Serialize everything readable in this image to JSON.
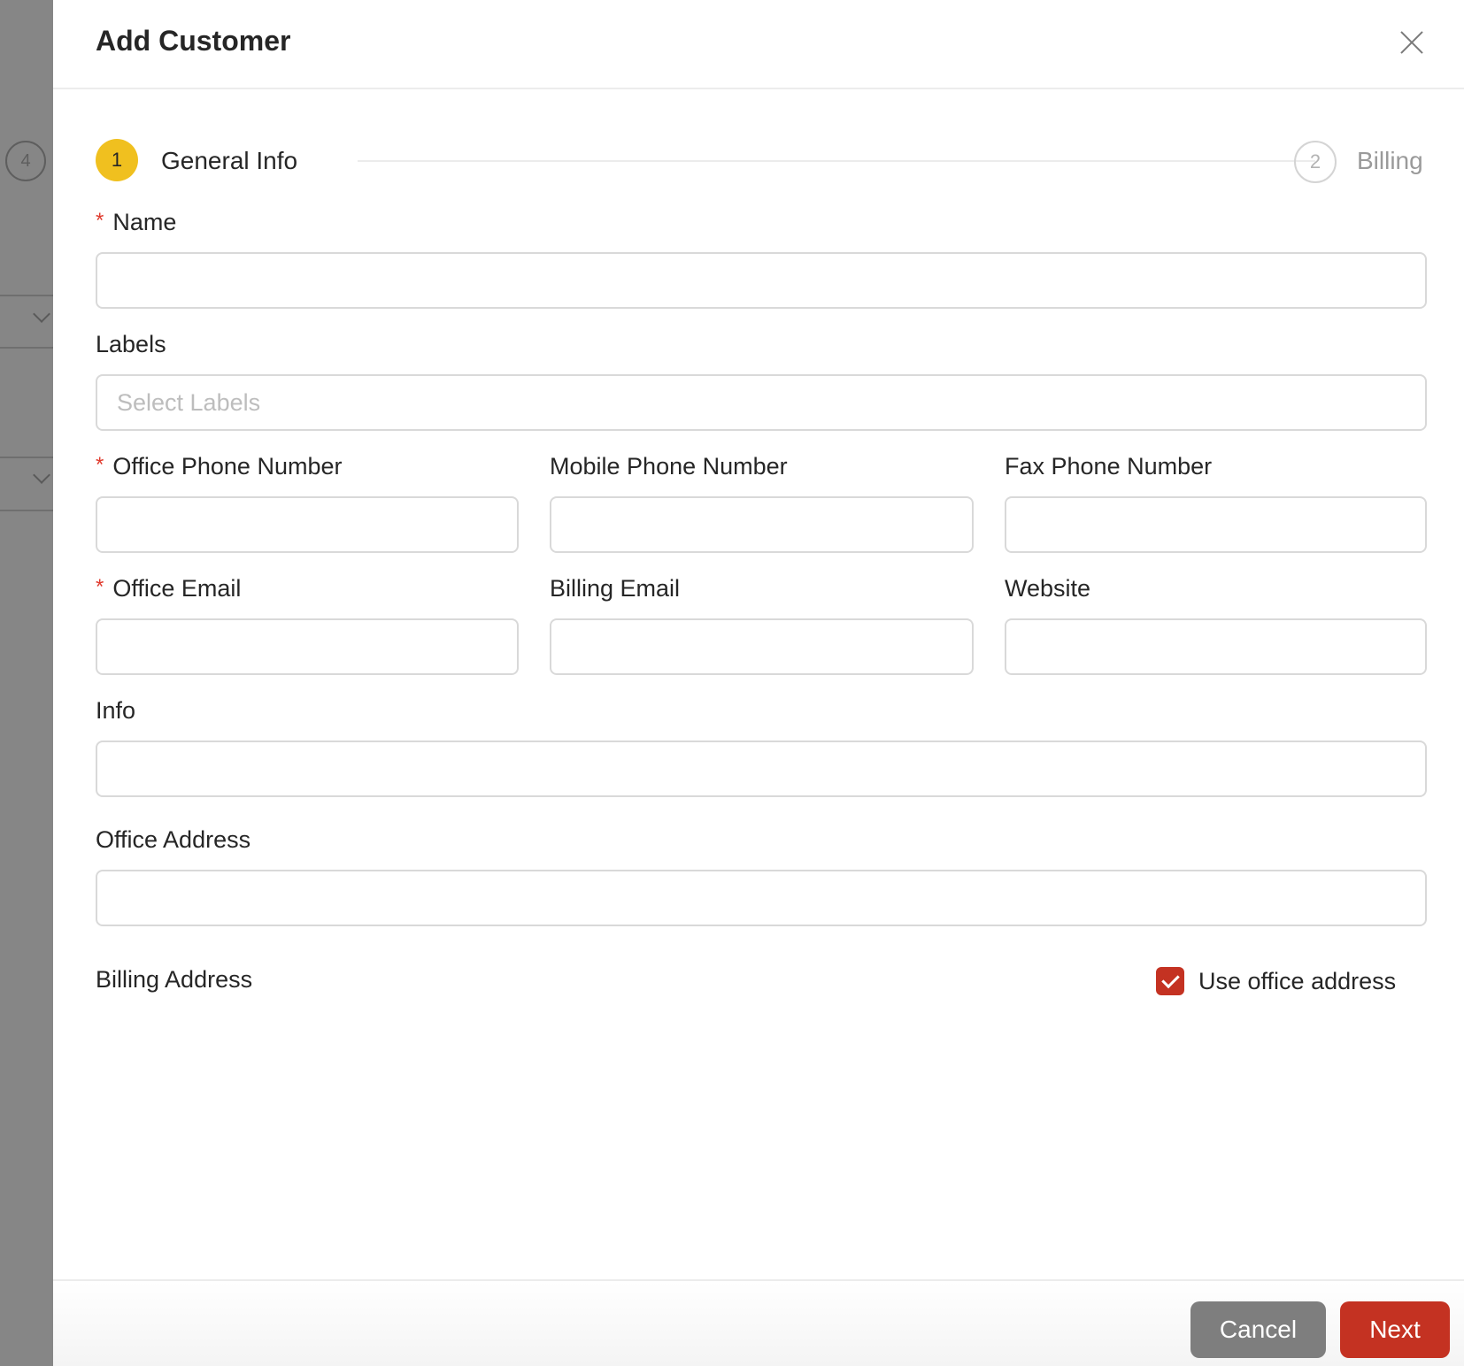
{
  "background": {
    "step_number": "4"
  },
  "drawer": {
    "title": "Add Customer"
  },
  "steps": [
    {
      "number": "1",
      "label": "General Info",
      "active": true
    },
    {
      "number": "2",
      "label": "Billing",
      "active": false
    }
  ],
  "form": {
    "name": {
      "label": "Name",
      "required": true,
      "value": ""
    },
    "labels": {
      "label": "Labels",
      "placeholder": "Select Labels"
    },
    "office_phone": {
      "label": "Office Phone Number",
      "required": true,
      "value": ""
    },
    "mobile_phone": {
      "label": "Mobile Phone Number",
      "value": ""
    },
    "fax_phone": {
      "label": "Fax Phone Number",
      "value": ""
    },
    "office_email": {
      "label": "Office Email",
      "required": true,
      "value": ""
    },
    "billing_email": {
      "label": "Billing Email",
      "value": ""
    },
    "website": {
      "label": "Website",
      "value": ""
    },
    "info": {
      "label": "Info",
      "value": ""
    },
    "office_address": {
      "label": "Office Address",
      "value": ""
    },
    "billing_address": {
      "label": "Billing Address"
    },
    "use_office_address": {
      "label": "Use office address",
      "checked": true
    }
  },
  "footer": {
    "cancel_label": "Cancel",
    "next_label": "Next"
  },
  "colors": {
    "accent_red": "#c43222",
    "step_active": "#f0c01f",
    "cancel_gray": "#7e7e7e",
    "required_star": "#e03b2e"
  },
  "icons": {
    "close": "close-icon",
    "check": "checkmark-icon",
    "chevron": "chevron-down-icon"
  }
}
